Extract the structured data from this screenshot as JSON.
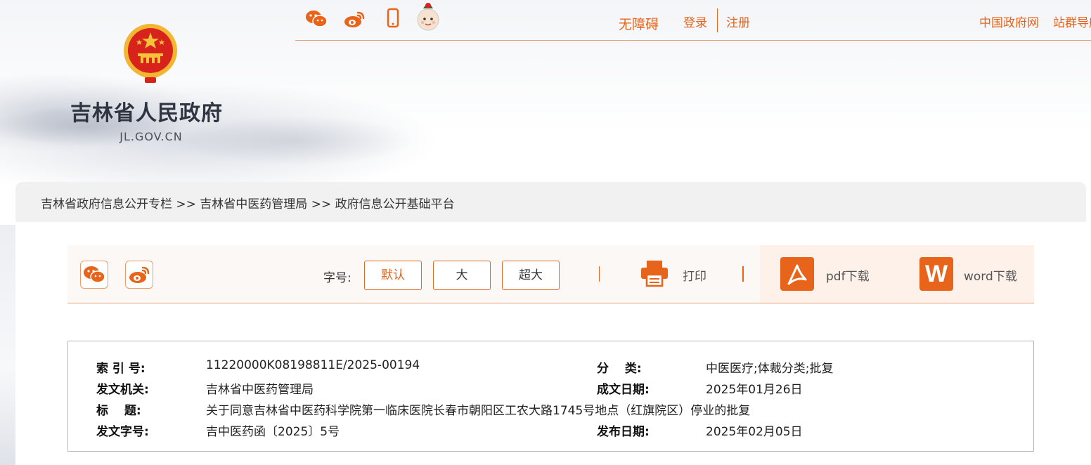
{
  "header": {
    "site_name": "吉林省人民政府",
    "site_domain": "JL.GOV.CN",
    "top_icons": [
      "wechat-icon",
      "weibo-icon",
      "mobile-icon",
      "mascot-icon"
    ],
    "accessibility": "无障碍",
    "login": "登录",
    "register": "注册",
    "gov_link": "中国政府网",
    "sites_link": "站群导航"
  },
  "breadcrumb": {
    "text": "吉林省政府信息公开专栏 >> 吉林省中医药管理局 >> 政府信息公开基础平台"
  },
  "toolbar": {
    "font_size_label": "字号:",
    "size_default": "默认",
    "size_large": "大",
    "size_xlarge": "超大",
    "print": "打印",
    "pdf_download": "pdf下载",
    "word_download": "word下载",
    "word_glyph": "W"
  },
  "info": {
    "index_label": "索 引 号:",
    "index_value": "11220000K08198811E/2025-00194",
    "category_label": "分　 类:",
    "category_value": "中医医疗;体裁分类;批复",
    "issuer_label": "发文机关:",
    "issuer_value": "吉林省中医药管理局",
    "date_written_label": "成文日期:",
    "date_written_value": "2025年01月26日",
    "title_label": "标　 题:",
    "title_value": "关于同意吉林省中医药科学院第一临床医院长春市朝阳区工农大路1745号地点（红旗院区）停业的批复",
    "doc_no_label": "发文字号:",
    "doc_no_value": "吉中医药函〔2025〕5号",
    "pub_date_label": "发布日期:",
    "pub_date_value": "2025年02月05日"
  },
  "colors": {
    "accent": "#e8641a",
    "emblem_red": "#d8231d",
    "emblem_gold": "#f5c23a"
  }
}
